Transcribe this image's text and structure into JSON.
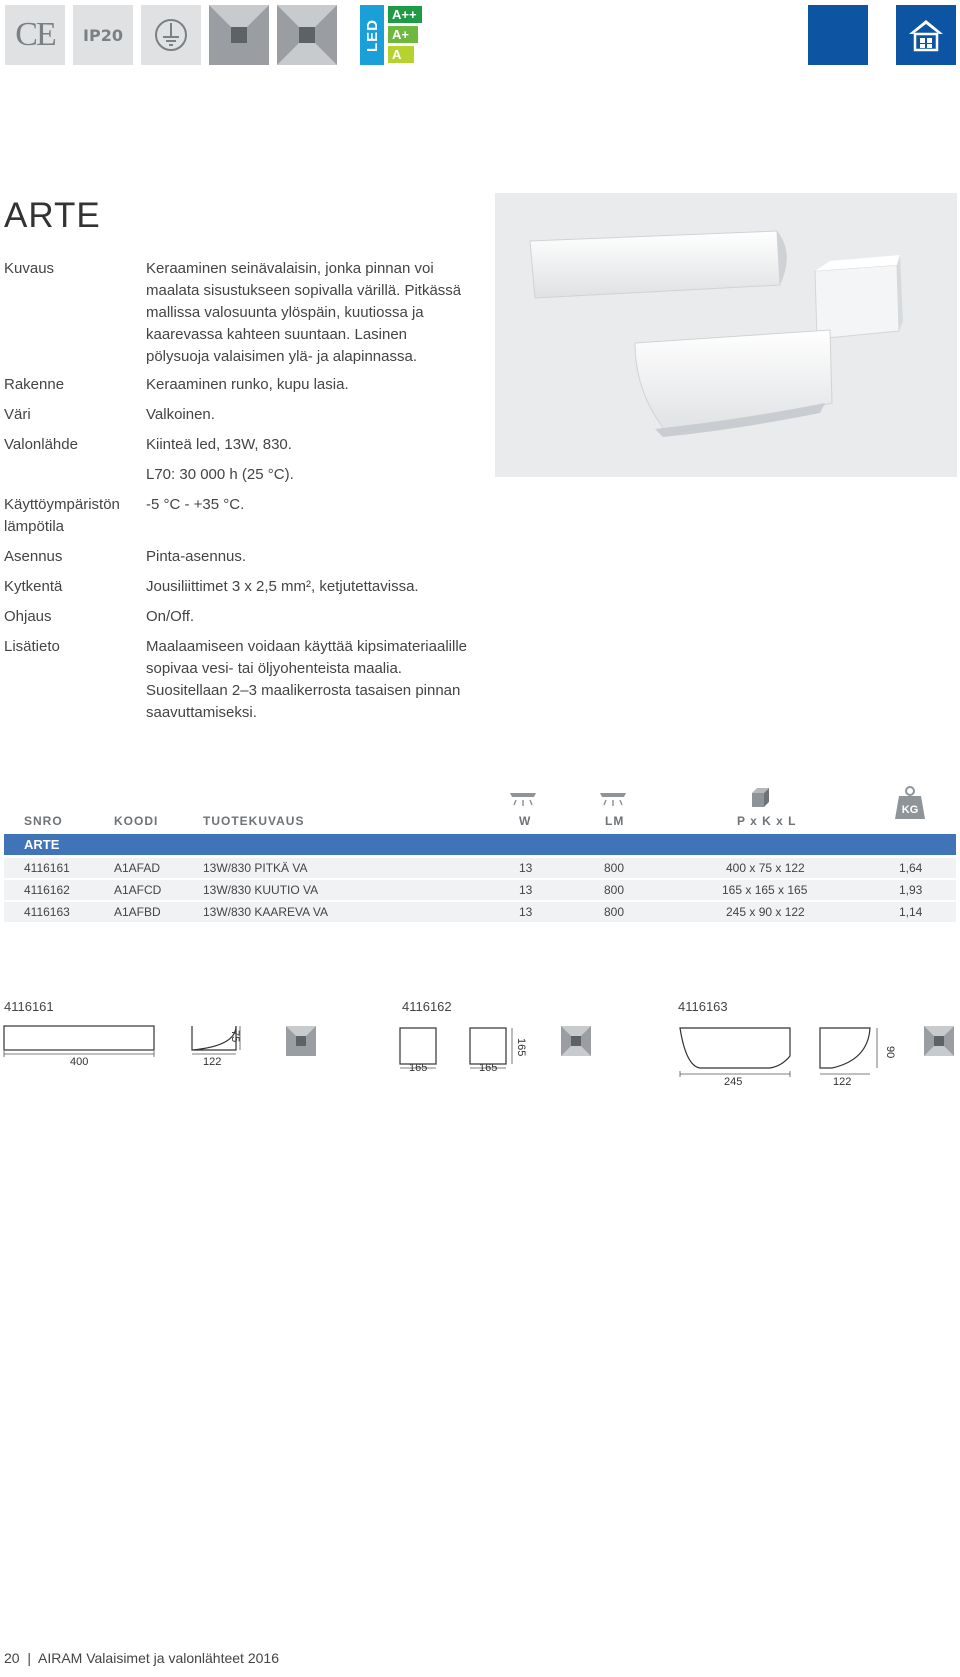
{
  "badges": {
    "ce": "CE",
    "ip": "IP20",
    "led": "LED",
    "energy_classes": [
      "A++",
      "A+",
      "A"
    ],
    "colors": {
      "a_plus_plus": "#1f9b48",
      "a_plus": "#6db83f",
      "a": "#b6d22e",
      "led": "#1a9fd8",
      "brand_blue": "#0d55a3"
    }
  },
  "product": {
    "title": "ARTE",
    "specs": [
      {
        "label": "Kuvaus",
        "value": "Keraaminen seinävalaisin, jonka pinnan voi maalata sisustukseen sopivalla värillä. Pitkäs­sä mallissa valosuunta ylöspäin, kuutiossa ja kaarevassa kahteen suuntaan. Lasinen pölysuoja valaisimen ylä- ja alapinnassa."
      },
      {
        "label": "Rakenne",
        "value": "Keraaminen runko, kupu lasia."
      },
      {
        "label": "Väri",
        "value": "Valkoinen."
      },
      {
        "label": "Valonlähde",
        "value": "Kiinteä led, 13W, 830."
      },
      {
        "label": "",
        "value": "L70: 30 000 h (25 °C)."
      },
      {
        "label": "Käyttöympäristön lämpötila",
        "value": "-5 °C - +35 °C."
      },
      {
        "label": "Asennus",
        "value": "Pinta-asennus."
      },
      {
        "label": "Kytkentä",
        "value": "Jousiliittimet 3 x 2,5 mm², ketjutettavissa."
      },
      {
        "label": "Ohjaus",
        "value": "On/Off."
      },
      {
        "label": "Lisätieto",
        "value": "Maalaamiseen voidaan käyttää kipsimateri­aalille sopivaa vesi- tai öljyohenteista maalia. Suositellaan 2–3 maalikerrosta tasaisen pinnan saavuttamiseksi."
      }
    ]
  },
  "table": {
    "headers": {
      "snro": "SNRO",
      "koodi": "KOODI",
      "tuotekuvaus": "TUOTEKUVAUS",
      "w": "W",
      "lm": "LM",
      "pxkxl": "P x K x L",
      "kg": "KG"
    },
    "group": "ARTE",
    "rows": [
      {
        "snro": "4116161",
        "koodi": "A1AFAD",
        "desc": "13W/830 PITKÄ VA",
        "w": "13",
        "lm": "800",
        "dims": "400 x 75 x 122",
        "kg": "1,64"
      },
      {
        "snro": "4116162",
        "koodi": "A1AFCD",
        "desc": "13W/830 KUUTIO VA",
        "w": "13",
        "lm": "800",
        "dims": "165 x 165 x 165",
        "kg": "1,93"
      },
      {
        "snro": "4116163",
        "koodi": "A1AFBD",
        "desc": "13W/830 KAAREVA VA",
        "w": "13",
        "lm": "800",
        "dims": "245 x 90 x 122",
        "kg": "1,14"
      }
    ]
  },
  "drawings": [
    {
      "id": "4116161",
      "dims": [
        "400",
        "122",
        "75"
      ]
    },
    {
      "id": "4116162",
      "dims": [
        "165",
        "165",
        "165"
      ]
    },
    {
      "id": "4116163",
      "dims": [
        "245",
        "122",
        "90"
      ]
    }
  ],
  "footer": "20  |  AIRAM Valaisimet ja valonlähteet 2016"
}
